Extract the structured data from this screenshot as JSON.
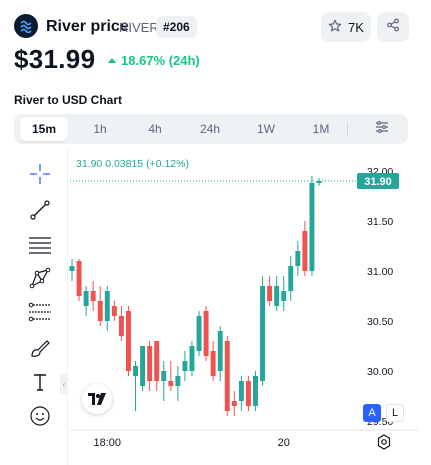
{
  "coin": {
    "name": "River price",
    "symbol": "RIVER",
    "rank": "#206",
    "watchlist_count": "7K",
    "price": "$31.99",
    "change": "18.67% (24h)",
    "logo_icon": "river-logo-icon",
    "up_color": "#16c784"
  },
  "chart_heading": "River to USD Chart",
  "timeframes": [
    "15m",
    "1h",
    "4h",
    "24h",
    "1W",
    "1M"
  ],
  "active_timeframe": "15m",
  "toolbar_icons": [
    "crosshair-icon",
    "trend-line-icon",
    "fib-lines-icon",
    "pattern-icon",
    "measure-icon",
    "brush-icon",
    "text-icon",
    "emoji-icon"
  ],
  "legend": {
    "last": "31.90",
    "change_abs": "0.03815",
    "change_pct": "(+0.12%)"
  },
  "price_tag": "31.90",
  "scale_buttons": {
    "auto": "A",
    "log": "L"
  },
  "chart_data": {
    "type": "candlestick",
    "y_ticks": [
      "32.00",
      "31.50",
      "31.00",
      "30.50",
      "30.00",
      "29.50"
    ],
    "ylim": [
      29.45,
      32.05
    ],
    "x_ticks": [
      {
        "label": "18:00",
        "index": 5
      },
      {
        "label": "20",
        "index": 30
      }
    ],
    "up_color": "#26a69a",
    "down_color": "#ef5350",
    "current_price": 31.9,
    "candles": [
      {
        "o": 31.0,
        "h": 31.12,
        "l": 30.9,
        "c": 31.05
      },
      {
        "o": 31.1,
        "h": 31.12,
        "l": 30.7,
        "c": 30.75
      },
      {
        "o": 30.65,
        "h": 30.85,
        "l": 30.55,
        "c": 30.8
      },
      {
        "o": 30.8,
        "h": 30.9,
        "l": 30.6,
        "c": 30.7
      },
      {
        "o": 30.7,
        "h": 30.85,
        "l": 30.45,
        "c": 30.5
      },
      {
        "o": 30.5,
        "h": 30.85,
        "l": 30.4,
        "c": 30.8
      },
      {
        "o": 30.65,
        "h": 30.7,
        "l": 30.5,
        "c": 30.55
      },
      {
        "o": 30.55,
        "h": 30.65,
        "l": 30.3,
        "c": 30.35
      },
      {
        "o": 30.6,
        "h": 30.65,
        "l": 29.95,
        "c": 30.0
      },
      {
        "o": 29.95,
        "h": 30.1,
        "l": 29.6,
        "c": 30.05
      },
      {
        "o": 29.85,
        "h": 30.25,
        "l": 29.8,
        "c": 30.25
      },
      {
        "o": 30.25,
        "h": 30.3,
        "l": 29.8,
        "c": 29.9
      },
      {
        "o": 30.3,
        "h": 30.3,
        "l": 29.8,
        "c": 29.9
      },
      {
        "o": 29.9,
        "h": 30.1,
        "l": 29.7,
        "c": 30.0
      },
      {
        "o": 29.9,
        "h": 30.1,
        "l": 29.8,
        "c": 29.85
      },
      {
        "o": 29.85,
        "h": 30.05,
        "l": 29.7,
        "c": 29.95
      },
      {
        "o": 30.0,
        "h": 30.2,
        "l": 29.9,
        "c": 30.1
      },
      {
        "o": 30.0,
        "h": 30.3,
        "l": 29.95,
        "c": 30.25
      },
      {
        "o": 30.2,
        "h": 30.6,
        "l": 30.15,
        "c": 30.55
      },
      {
        "o": 30.6,
        "h": 30.65,
        "l": 30.1,
        "c": 30.15
      },
      {
        "o": 30.2,
        "h": 30.3,
        "l": 29.9,
        "c": 29.95
      },
      {
        "o": 30.0,
        "h": 30.45,
        "l": 29.9,
        "c": 30.4
      },
      {
        "o": 30.3,
        "h": 30.35,
        "l": 29.55,
        "c": 29.6
      },
      {
        "o": 29.7,
        "h": 29.8,
        "l": 29.55,
        "c": 29.65
      },
      {
        "o": 29.7,
        "h": 29.95,
        "l": 29.6,
        "c": 29.9
      },
      {
        "o": 29.9,
        "h": 29.95,
        "l": 29.6,
        "c": 29.65
      },
      {
        "o": 29.65,
        "h": 30.0,
        "l": 29.6,
        "c": 29.95
      },
      {
        "o": 29.9,
        "h": 30.95,
        "l": 29.85,
        "c": 30.85
      },
      {
        "o": 30.85,
        "h": 30.95,
        "l": 30.65,
        "c": 30.7
      },
      {
        "o": 30.65,
        "h": 30.95,
        "l": 30.6,
        "c": 30.85
      },
      {
        "o": 30.7,
        "h": 30.95,
        "l": 30.6,
        "c": 30.8
      },
      {
        "o": 30.8,
        "h": 31.15,
        "l": 30.7,
        "c": 31.05
      },
      {
        "o": 31.05,
        "h": 31.3,
        "l": 30.95,
        "c": 31.2
      },
      {
        "o": 31.4,
        "h": 31.5,
        "l": 30.95,
        "c": 31.0
      },
      {
        "o": 31.0,
        "h": 31.95,
        "l": 30.95,
        "c": 31.88
      },
      {
        "o": 31.88,
        "h": 31.93,
        "l": 31.85,
        "c": 31.9
      }
    ]
  }
}
